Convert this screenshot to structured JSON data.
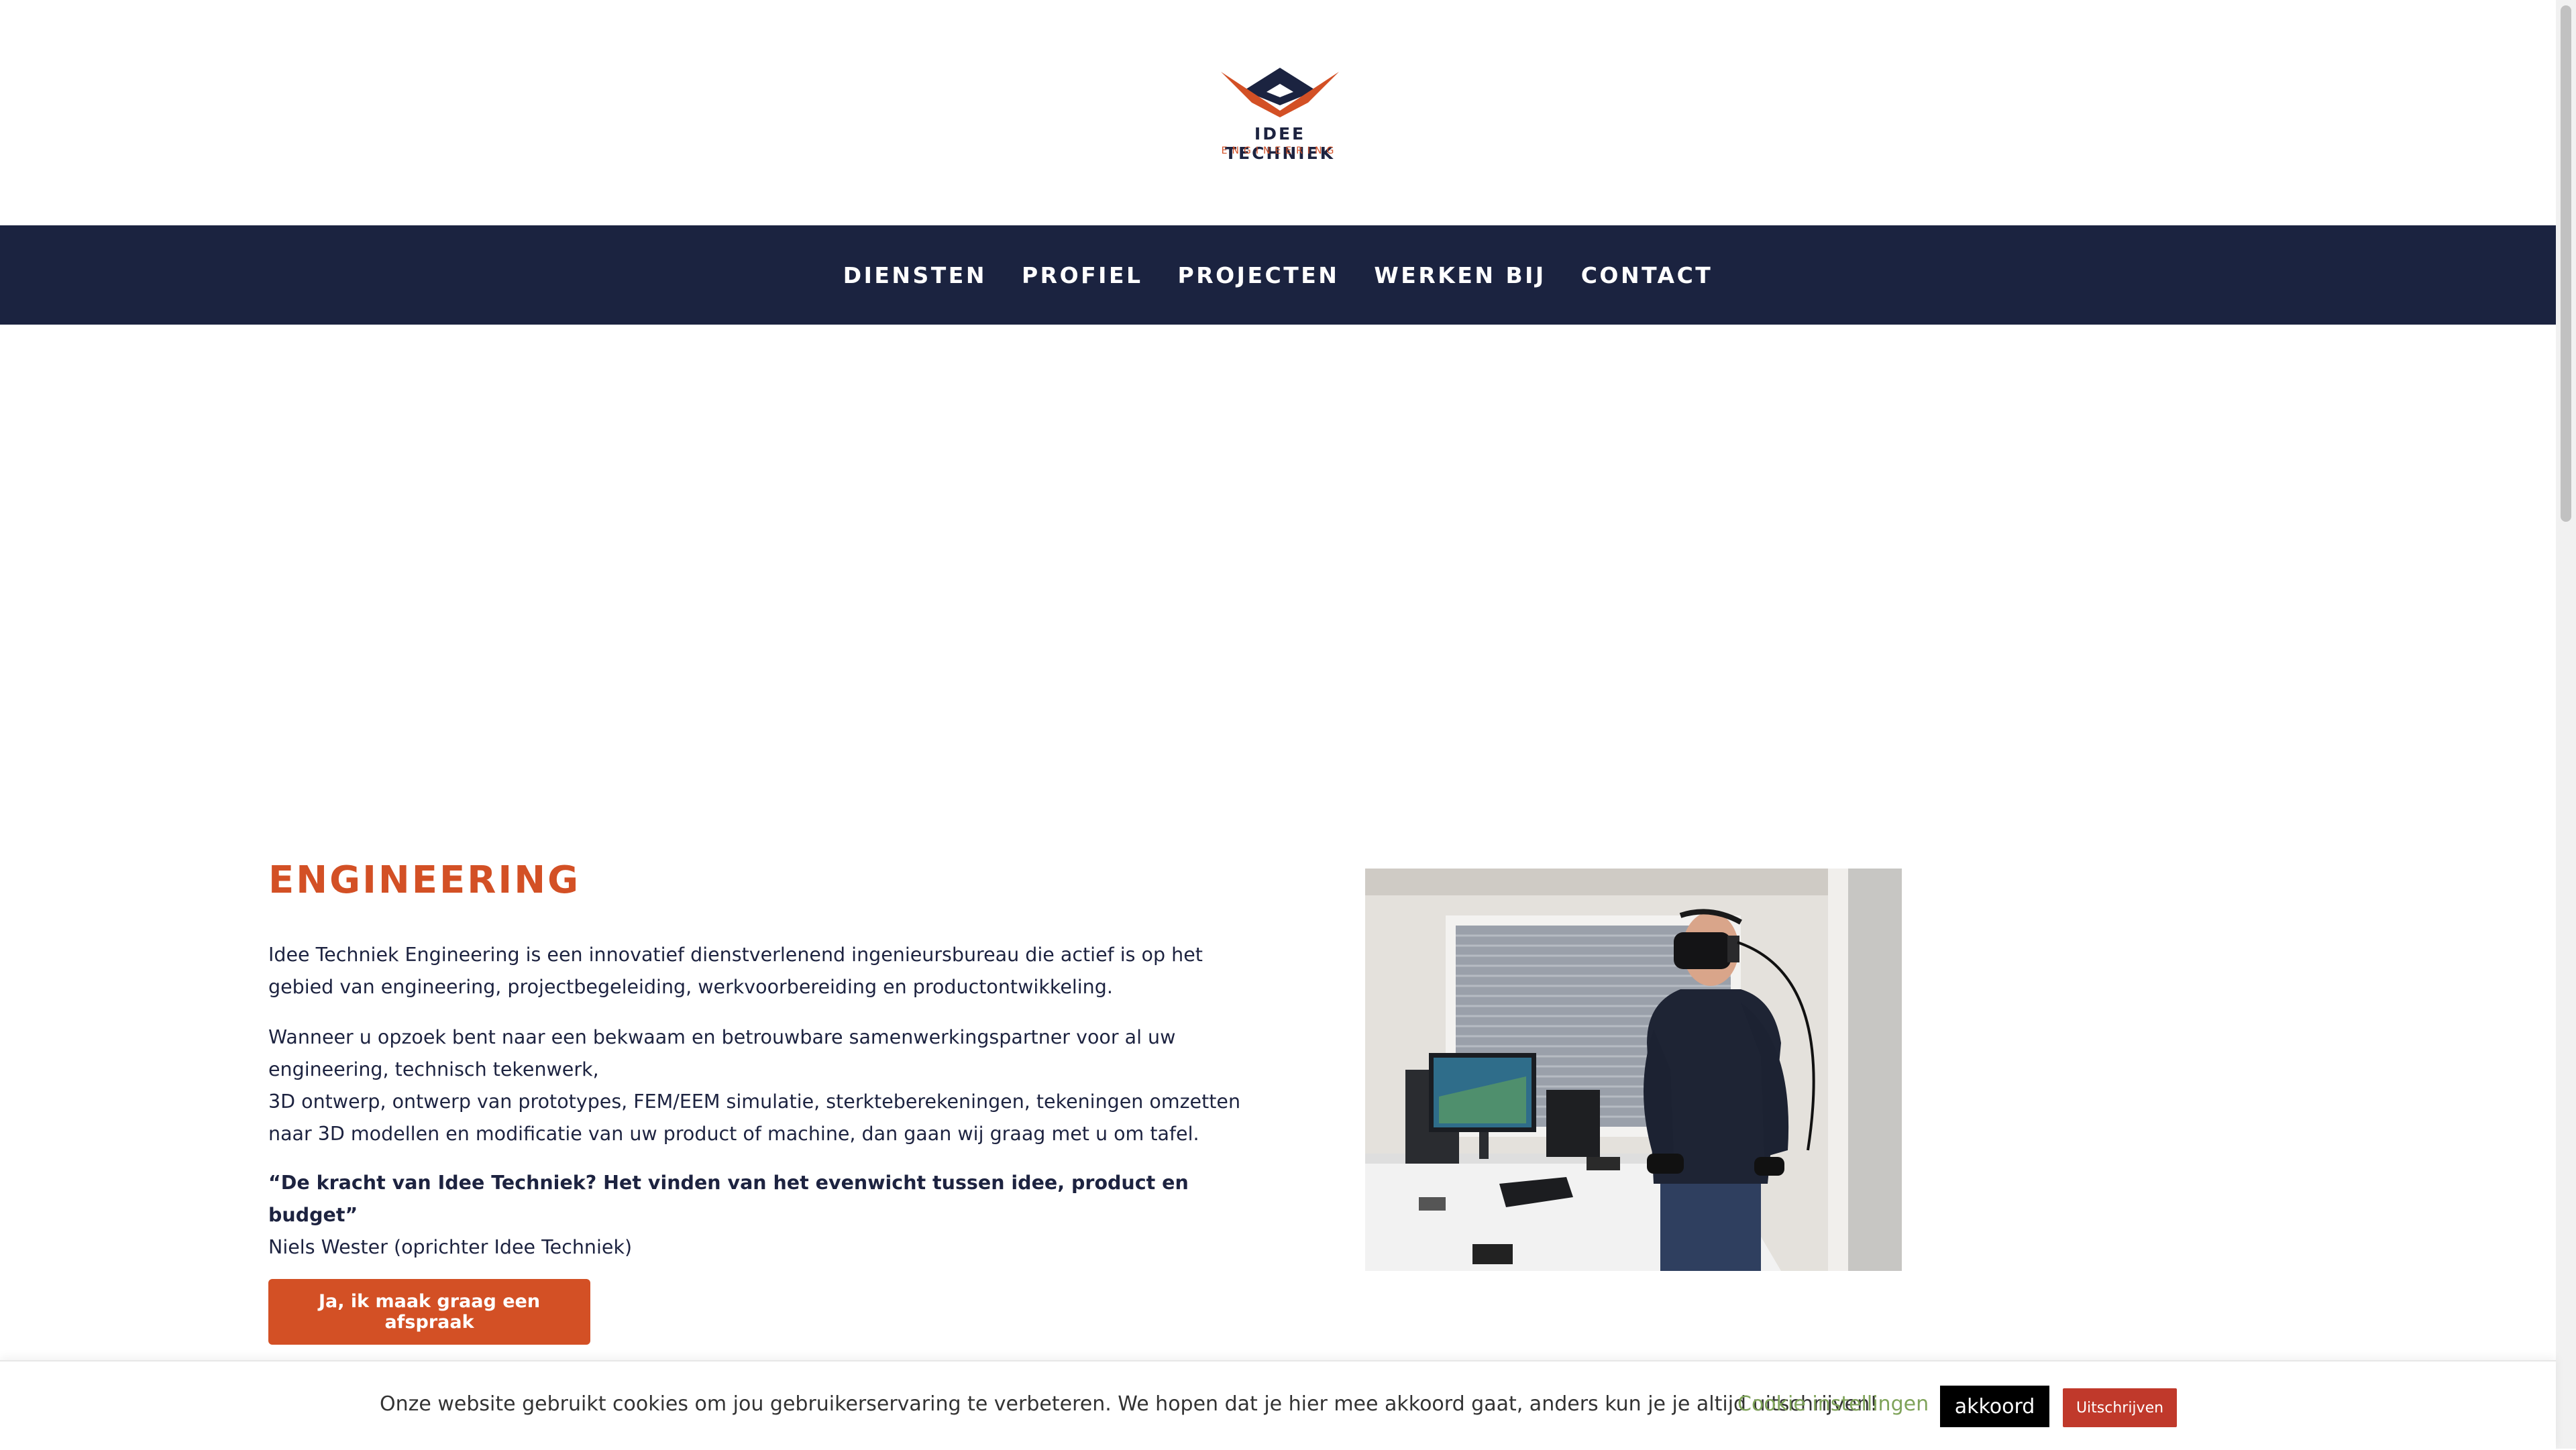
{
  "brand": {
    "name": "IDEE TECHNIEK",
    "tagline": "ENGINEERING",
    "colors": {
      "navy": "#1b2340",
      "orange": "#d35025",
      "green": "#7fa35a",
      "red": "#c0392b"
    }
  },
  "nav": {
    "items": [
      {
        "label": "DIENSTEN"
      },
      {
        "label": "PROFIEL"
      },
      {
        "label": "PROJECTEN"
      },
      {
        "label": "WERKEN BIJ"
      },
      {
        "label": "CONTACT"
      }
    ]
  },
  "main": {
    "heading": "ENGINEERING",
    "p1": "Idee Techniek Engineering is een innovatief dienstverlenend ingenieursbureau die actief is op het gebied van engineering, projectbegeleiding, werkvoorbereiding en productontwikkeling.",
    "p2_line1": "Wanneer u opzoek bent naar een bekwaam en betrouwbare samenwerkingspartner voor al uw engineering, technisch tekenwerk,",
    "p2_line2": "3D ontwerp, ontwerp van prototypes, FEM/EEM simulatie, sterkteberekeningen, tekeningen omzetten naar 3D modellen en modificatie van uw product of machine, dan gaan wij graag met u om tafel.",
    "quote": "“De kracht van Idee Techniek? Het vinden van het evenwicht tussen idee, product en budget”",
    "author": "Niels Wester (oprichter Idee Techniek)",
    "cta_label": "Ja, ik maak graag een afspraak"
  },
  "cookie": {
    "text": "Onze website gebruikt cookies om jou gebruikerservaring te verbeteren. We hopen dat je hier mee akkoord gaat, anders kun je je altijd uitschrijven!",
    "settings_label": "Cookie instellingen",
    "accept_label": "akkoord",
    "reject_label": "Uitschrijven"
  }
}
